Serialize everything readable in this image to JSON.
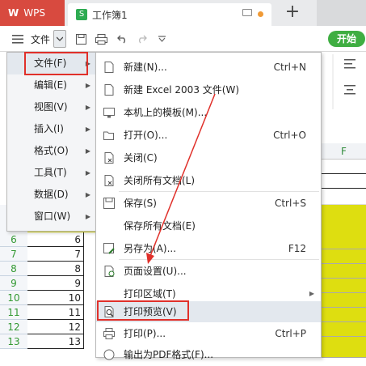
{
  "titlebar": {
    "app_label": "WPS",
    "doc_tab": "工作簿1",
    "new_tab": "+"
  },
  "toolbar": {
    "file_label": "文件",
    "start_label": "开始"
  },
  "main_menu": {
    "items": [
      {
        "label": "文件(F)",
        "icon": "arrow-right-icon"
      },
      {
        "label": "编辑(E)"
      },
      {
        "label": "视图(V)"
      },
      {
        "label": "插入(I)"
      },
      {
        "label": "格式(O)"
      },
      {
        "label": "工具(T)"
      },
      {
        "label": "数据(D)"
      },
      {
        "label": "窗口(W)"
      }
    ]
  },
  "file_submenu": {
    "items": [
      {
        "label": "新建(N)...",
        "shortcut": "Ctrl+N",
        "icon": "new-doc-icon"
      },
      {
        "label": "新建 Excel 2003 文件(W)",
        "shortcut": "",
        "icon": "new-doc-icon"
      },
      {
        "label": "本机上的模板(M)...",
        "shortcut": "",
        "icon": "template-icon"
      },
      {
        "label": "打开(O)...",
        "shortcut": "Ctrl+O",
        "icon": "folder-open-icon"
      },
      {
        "label": "关闭(C)",
        "shortcut": "",
        "icon": "close-doc-icon"
      },
      {
        "label": "关闭所有文档(L)",
        "shortcut": "",
        "icon": "close-all-icon"
      },
      {
        "label": "保存(S)",
        "shortcut": "Ctrl+S",
        "icon": "save-icon"
      },
      {
        "label": "保存所有文档(E)",
        "shortcut": "",
        "icon": ""
      },
      {
        "label": "另存为(A)...",
        "shortcut": "F12",
        "icon": "save-as-icon"
      },
      {
        "label": "页面设置(U)...",
        "shortcut": "",
        "icon": "page-setup-icon"
      },
      {
        "label": "打印区域(T)",
        "shortcut": "",
        "icon": ""
      },
      {
        "label": "打印预览(V)",
        "shortcut": "",
        "icon": "print-preview-icon"
      },
      {
        "label": "打印(P)...",
        "shortcut": "Ctrl+P",
        "icon": "print-icon"
      },
      {
        "label": "输出为PDF格式(F)...",
        "shortcut": "",
        "icon": "pdf-icon"
      }
    ]
  },
  "sheet": {
    "column_f": "F",
    "rows": [
      {
        "header": "6",
        "value": "6"
      },
      {
        "header": "7",
        "value": "7"
      },
      {
        "header": "8",
        "value": "8"
      },
      {
        "header": "9",
        "value": "9"
      },
      {
        "header": "10",
        "value": "10"
      },
      {
        "header": "11",
        "value": "11"
      },
      {
        "header": "12",
        "value": "12"
      },
      {
        "header": "13",
        "value": "13"
      }
    ]
  },
  "colors": {
    "wps_red": "#d84a3f",
    "start_green": "#3fae42",
    "row_number_green": "#339933",
    "cell_yellow": "#dede10",
    "annotation_red": "#e0302a"
  }
}
